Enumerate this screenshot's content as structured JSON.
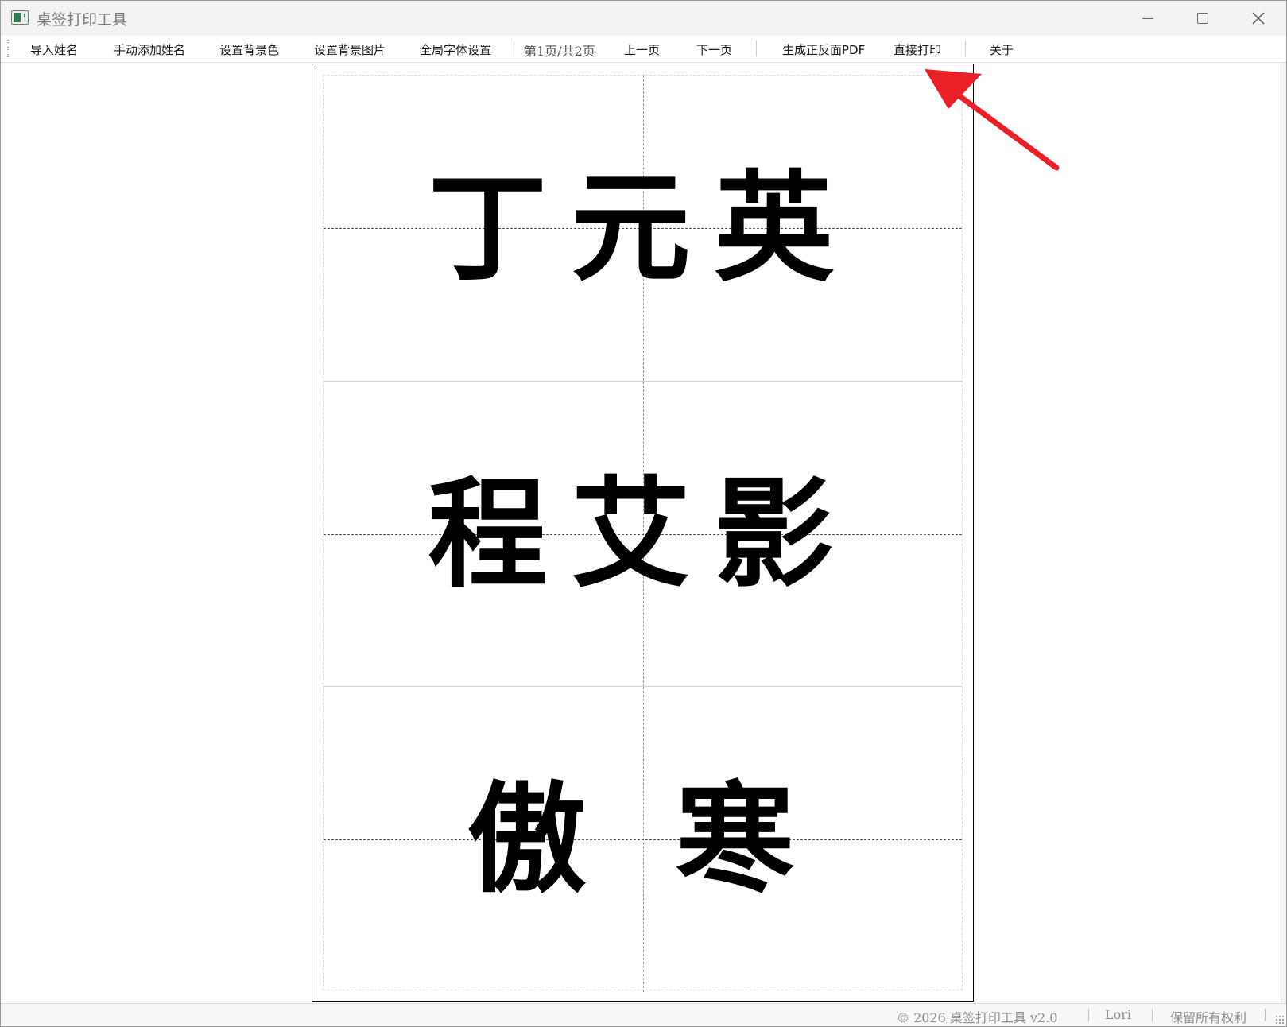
{
  "window": {
    "title": "桌签打印工具"
  },
  "toolbar": {
    "import_names": "导入姓名",
    "add_name": "手动添加姓名",
    "set_bg_color": "设置背景色",
    "set_bg_image": "设置背景图片",
    "font_settings": "全局字体设置",
    "page_indicator": "第1页/共2页",
    "prev_page": "上一页",
    "next_page": "下一页",
    "generate_pdf": "生成正反面PDF",
    "direct_print": "直接打印",
    "about": "关于"
  },
  "cards": [
    {
      "name": "丁元英"
    },
    {
      "name": "程艾影"
    },
    {
      "name": "傲 寒"
    }
  ],
  "status": {
    "copyright": "© 2026 桌签打印工具 v2.0",
    "author": "Lori",
    "rights": "保留所有权利"
  },
  "annotation": {
    "arrow_color": "#ea2027"
  }
}
